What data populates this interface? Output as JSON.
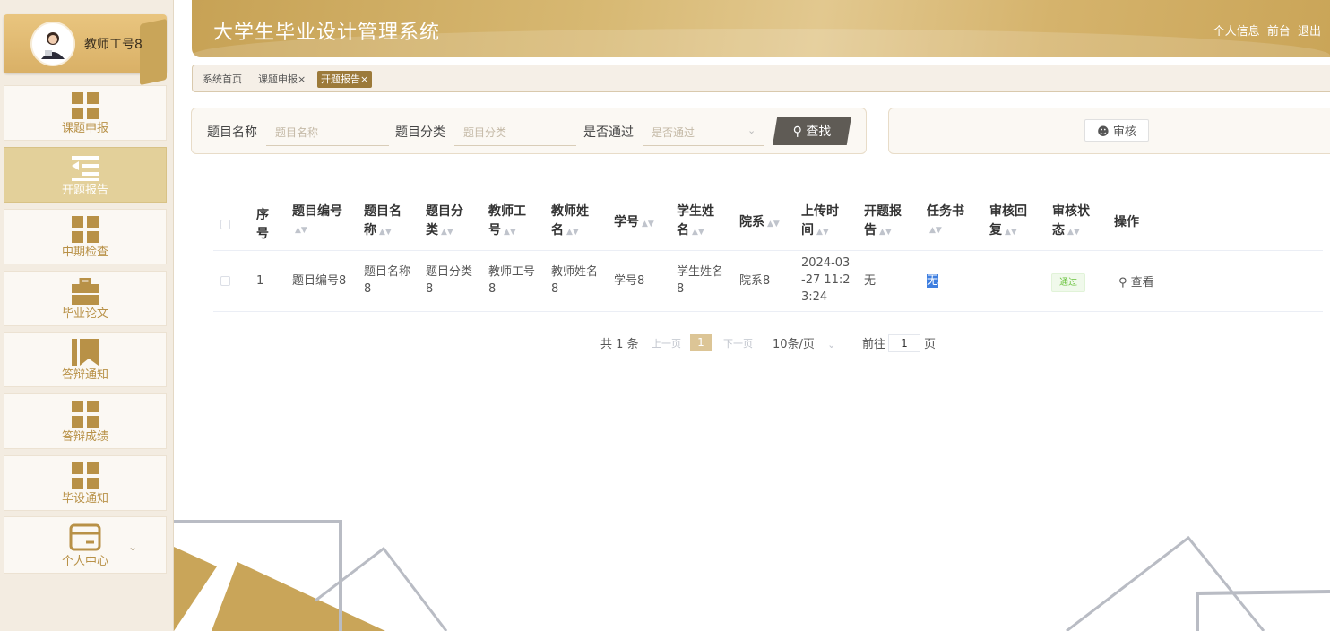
{
  "user": {
    "name": "教师工号8"
  },
  "sidebar": {
    "items": [
      {
        "label": "课题申报",
        "icon": "grid-icon"
      },
      {
        "label": "开题报告",
        "icon": "indent-list-icon"
      },
      {
        "label": "中期检查",
        "icon": "grid-icon"
      },
      {
        "label": "毕业论文",
        "icon": "briefcase-icon"
      },
      {
        "label": "答辩通知",
        "icon": "bookmark-icon"
      },
      {
        "label": "答辩成绩",
        "icon": "grid-icon"
      },
      {
        "label": "毕设通知",
        "icon": "grid-icon"
      },
      {
        "label": "个人中心",
        "icon": "card-icon"
      }
    ]
  },
  "header": {
    "title": "大学生毕业设计管理系统",
    "links": [
      "个人信息",
      "前台",
      "退出"
    ]
  },
  "tabs": [
    {
      "label": "系统首页"
    },
    {
      "label": "课题申报×"
    },
    {
      "label": "开题报告×"
    }
  ],
  "search": {
    "fields": [
      {
        "label": "题目名称",
        "placeholder": "题目名称"
      },
      {
        "label": "题目分类",
        "placeholder": "题目分类"
      },
      {
        "label": "是否通过",
        "placeholder": "是否通过"
      }
    ],
    "button": "查找"
  },
  "actions": {
    "audit": "审核"
  },
  "table": {
    "headers": [
      [
        "序",
        "号"
      ],
      [
        "题目编号"
      ],
      [
        "题目名",
        "称"
      ],
      [
        "题目分",
        "类"
      ],
      [
        "教师工",
        "号"
      ],
      [
        "教师姓",
        "名"
      ],
      [
        "学号"
      ],
      [
        "学生姓",
        "名"
      ],
      [
        "院系"
      ],
      [
        "上传时",
        "间"
      ],
      [
        "开题报",
        "告"
      ],
      [
        "任务书"
      ],
      [
        "审核回",
        "复"
      ],
      [
        "审核状",
        "态"
      ],
      [
        "操作"
      ]
    ],
    "rows": [
      {
        "index": "1",
        "topic_no": "题目编号8",
        "topic_name": [
          "题目名称",
          "8"
        ],
        "topic_cat": [
          "题目分类",
          "8"
        ],
        "teacher_no": [
          "教师工号",
          "8"
        ],
        "teacher_name": [
          "教师姓名",
          "8"
        ],
        "student_no": "学号8",
        "student_name": [
          "学生姓名",
          "8"
        ],
        "dept": "院系8",
        "upload_time": [
          "2024-03",
          "-27 11:2",
          "3:24"
        ],
        "report": "无",
        "task": "无",
        "reply": "",
        "status": "通过",
        "op": "查看"
      }
    ]
  },
  "pagination": {
    "total": "共 1 条",
    "prev": "上一页",
    "current": "1",
    "next": "下一页",
    "page_size": "10条/页",
    "goto_label": "前往",
    "goto_value": "1",
    "goto_suffix": "页"
  },
  "colors": {
    "accent": "#c9a559",
    "active_nav": "#e3d09a",
    "tab_active": "#9c7a3a"
  }
}
